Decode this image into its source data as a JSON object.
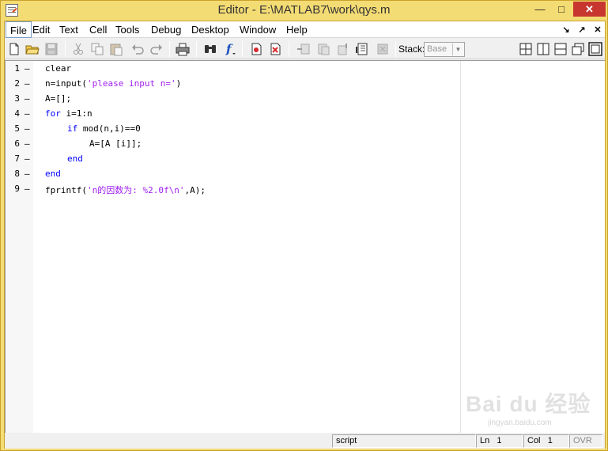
{
  "window": {
    "title": "Editor - E:\\MATLAB7\\work\\qys.m",
    "min_glyph": "—",
    "max_glyph": "□",
    "close_glyph": "✕"
  },
  "menu": {
    "items": [
      "File",
      "Edit",
      "Text",
      "Cell",
      "Tools",
      "Debug",
      "Desktop",
      "Window",
      "Help"
    ],
    "undock_glyph": "↘",
    "dock_glyph": "↗",
    "close_glyph": "✕"
  },
  "toolbar": {
    "stack_label": "Stack:",
    "stack_value": "Base",
    "icons": [
      "new-file-icon",
      "open-folder-icon",
      "save-icon",
      "cut-icon",
      "copy-icon",
      "paste-icon",
      "undo-icon",
      "redo-icon",
      "print-icon",
      "find-icon",
      "function-icon",
      "set-breakpoint-icon",
      "clear-breakpoints-icon",
      "step-icon",
      "step-in-icon",
      "step-out-icon",
      "run-icon",
      "exit-debug-icon",
      "tile-icon",
      "split-vertical-icon",
      "split-horizontal-icon",
      "float-icon",
      "maximize-icon"
    ]
  },
  "editor": {
    "lines": [
      {
        "n": "1",
        "indent": 0,
        "parts": [
          {
            "t": "clear",
            "c": "plain"
          }
        ]
      },
      {
        "n": "2",
        "indent": 0,
        "parts": [
          {
            "t": "n=input(",
            "c": "plain"
          },
          {
            "t": "'please input n='",
            "c": "str"
          },
          {
            "t": ")",
            "c": "plain"
          }
        ]
      },
      {
        "n": "3",
        "indent": 0,
        "parts": [
          {
            "t": "A=[];",
            "c": "plain"
          }
        ]
      },
      {
        "n": "4",
        "indent": 0,
        "parts": [
          {
            "t": "for",
            "c": "kw"
          },
          {
            "t": " i=1:n",
            "c": "plain"
          }
        ]
      },
      {
        "n": "5",
        "indent": 1,
        "parts": [
          {
            "t": "if",
            "c": "kw"
          },
          {
            "t": " mod(n,i)==0",
            "c": "plain"
          }
        ]
      },
      {
        "n": "6",
        "indent": 2,
        "parts": [
          {
            "t": "A=[A [i]];",
            "c": "plain"
          }
        ]
      },
      {
        "n": "7",
        "indent": 1,
        "parts": [
          {
            "t": "end",
            "c": "kw"
          }
        ]
      },
      {
        "n": "8",
        "indent": 0,
        "parts": [
          {
            "t": "end",
            "c": "kw"
          }
        ]
      },
      {
        "n": "9",
        "indent": 0,
        "parts": [
          {
            "t": "fprintf(",
            "c": "plain"
          },
          {
            "t": "'n的因数为: %2.0f\\n'",
            "c": "str"
          },
          {
            "t": ",A);",
            "c": "plain"
          }
        ]
      }
    ],
    "dash": "–"
  },
  "status": {
    "mode": "script",
    "ln_label": "Ln",
    "ln_value": "1",
    "col_label": "Col",
    "col_value": "1",
    "ovr": "OVR"
  },
  "watermark": {
    "text": "Bai du 经验",
    "sub": "jingyan.baidu.com"
  },
  "colors": {
    "keyword": "#0000ff",
    "string": "#a020f0",
    "frame": "#f4dc74"
  }
}
